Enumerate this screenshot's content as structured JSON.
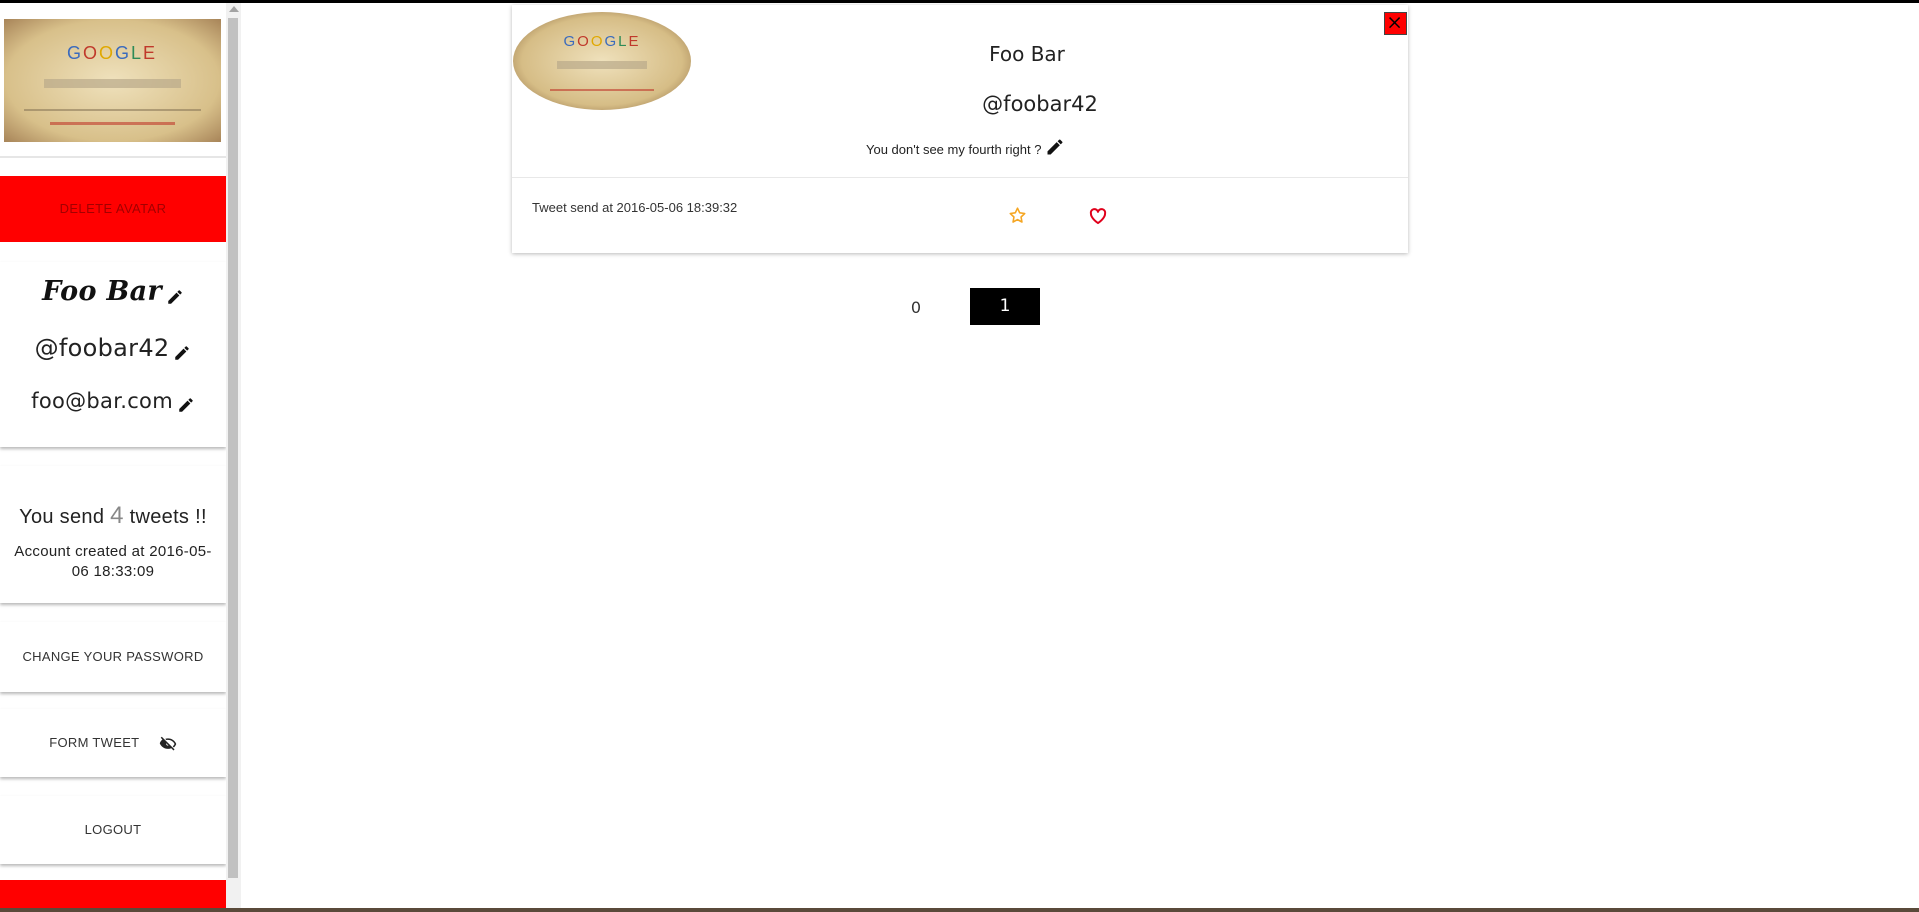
{
  "sidebar": {
    "avatar_logo_text": "GOOGLE",
    "avatar_tagline": "PLEASE ALLOW 10 DAYS FOR SEARCH RESULTS",
    "delete_avatar_label": "DELETE AVATAR",
    "profile": {
      "name": "Foo Bar",
      "handle": "@foobar42",
      "email": "foo@bar.com"
    },
    "stats": {
      "prefix": "You send",
      "count": "4",
      "suffix": "tweets !!",
      "created_line1": "Account created at 2016-05-",
      "created_line2": "06 18:33:09"
    },
    "menu": {
      "change_password": "CHANGE YOUR PASSWORD",
      "form_tweet": "FORM TWEET",
      "logout": "LOGOUT"
    }
  },
  "tweet": {
    "author_name": "Foo Bar",
    "author_handle": "@foobar42",
    "text": "You don't see my fourth right ?",
    "date_label": "Tweet send at 2016-05-06 18:39:32",
    "avatar_logo_text": "GOOGLE"
  },
  "pagination": {
    "pages": [
      "0",
      "1"
    ],
    "current": "1"
  },
  "colors": {
    "danger": "#ff0000",
    "star": "#f5a623",
    "heart": "#e0001b",
    "active_page_bg": "#000000"
  },
  "icons": {
    "edit": "pencil-icon",
    "hide": "eye-off-icon",
    "favorite": "star-icon",
    "like": "heart-icon",
    "close": "close-icon"
  }
}
